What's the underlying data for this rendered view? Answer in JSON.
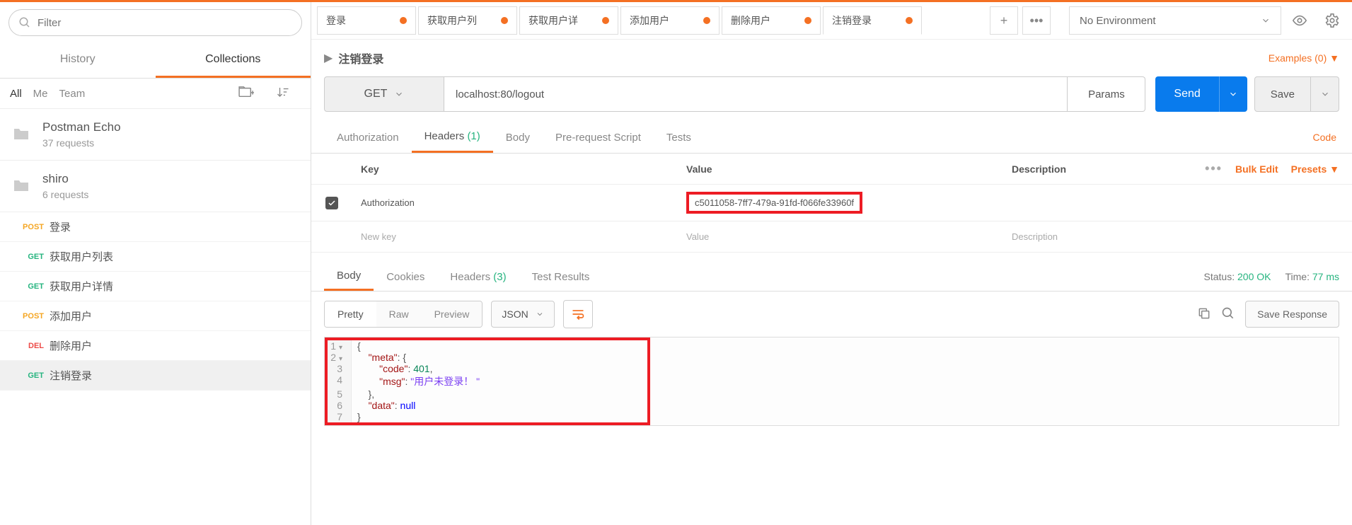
{
  "sidebar": {
    "filter_placeholder": "Filter",
    "tabs": {
      "history": "History",
      "collections": "Collections"
    },
    "scopes": {
      "all": "All",
      "me": "Me",
      "team": "Team"
    },
    "collections": [
      {
        "name": "Postman Echo",
        "sub": "37 requests"
      },
      {
        "name": "shiro",
        "sub": "6 requests"
      }
    ],
    "requests": [
      {
        "method": "POST",
        "mclass": "m-post",
        "name": "登录"
      },
      {
        "method": "GET",
        "mclass": "m-get",
        "name": "获取用户列表"
      },
      {
        "method": "GET",
        "mclass": "m-get",
        "name": "获取用户详情"
      },
      {
        "method": "POST",
        "mclass": "m-post",
        "name": "添加用户"
      },
      {
        "method": "DEL",
        "mclass": "m-del",
        "name": "删除用户"
      },
      {
        "method": "GET",
        "mclass": "m-get",
        "name": "注销登录"
      }
    ]
  },
  "tabs": [
    {
      "label": "登录"
    },
    {
      "label": "获取用户列"
    },
    {
      "label": "获取用户详"
    },
    {
      "label": "添加用户"
    },
    {
      "label": "删除用户"
    },
    {
      "label": "注销登录"
    }
  ],
  "env": {
    "label": "No Environment"
  },
  "request": {
    "title": "注销登录",
    "examples": "Examples (0)",
    "method": "GET",
    "url": "localhost:80/logout",
    "params": "Params",
    "send": "Send",
    "save": "Save",
    "tabs": {
      "authorization": "Authorization",
      "headers": "Headers",
      "headers_count": "(1)",
      "body": "Body",
      "prerequest": "Pre-request Script",
      "tests": "Tests"
    },
    "code_link": "Code",
    "headers_table": {
      "head_key": "Key",
      "head_value": "Value",
      "head_desc": "Description",
      "bulk_edit": "Bulk Edit",
      "presets": "Presets",
      "rows": [
        {
          "key": "Authorization",
          "value": "c5011058-7ff7-479a-91fd-f066fe33960f",
          "desc": ""
        }
      ],
      "new_key": "New key",
      "new_value": "Value",
      "new_desc": "Description"
    }
  },
  "response": {
    "tabs": {
      "body": "Body",
      "cookies": "Cookies",
      "headers": "Headers",
      "headers_count": "(3)",
      "test_results": "Test Results"
    },
    "status_label": "Status:",
    "status_value": "200 OK",
    "time_label": "Time:",
    "time_value": "77 ms",
    "views": {
      "pretty": "Pretty",
      "raw": "Raw",
      "preview": "Preview"
    },
    "format": "JSON",
    "save_response": "Save Response",
    "body_lines": [
      {
        "n": "1",
        "fold": "▾",
        "t": "{"
      },
      {
        "n": "2",
        "fold": "▾",
        "t": "    \"meta\": {"
      },
      {
        "n": "3",
        "fold": "",
        "t": "        \"code\": 401,"
      },
      {
        "n": "4",
        "fold": "",
        "t": "        \"msg\": \"用户未登录！\""
      },
      {
        "n": "5",
        "fold": "",
        "t": "    },"
      },
      {
        "n": "6",
        "fold": "",
        "t": "    \"data\": null"
      },
      {
        "n": "7",
        "fold": "",
        "t": "}"
      }
    ]
  }
}
